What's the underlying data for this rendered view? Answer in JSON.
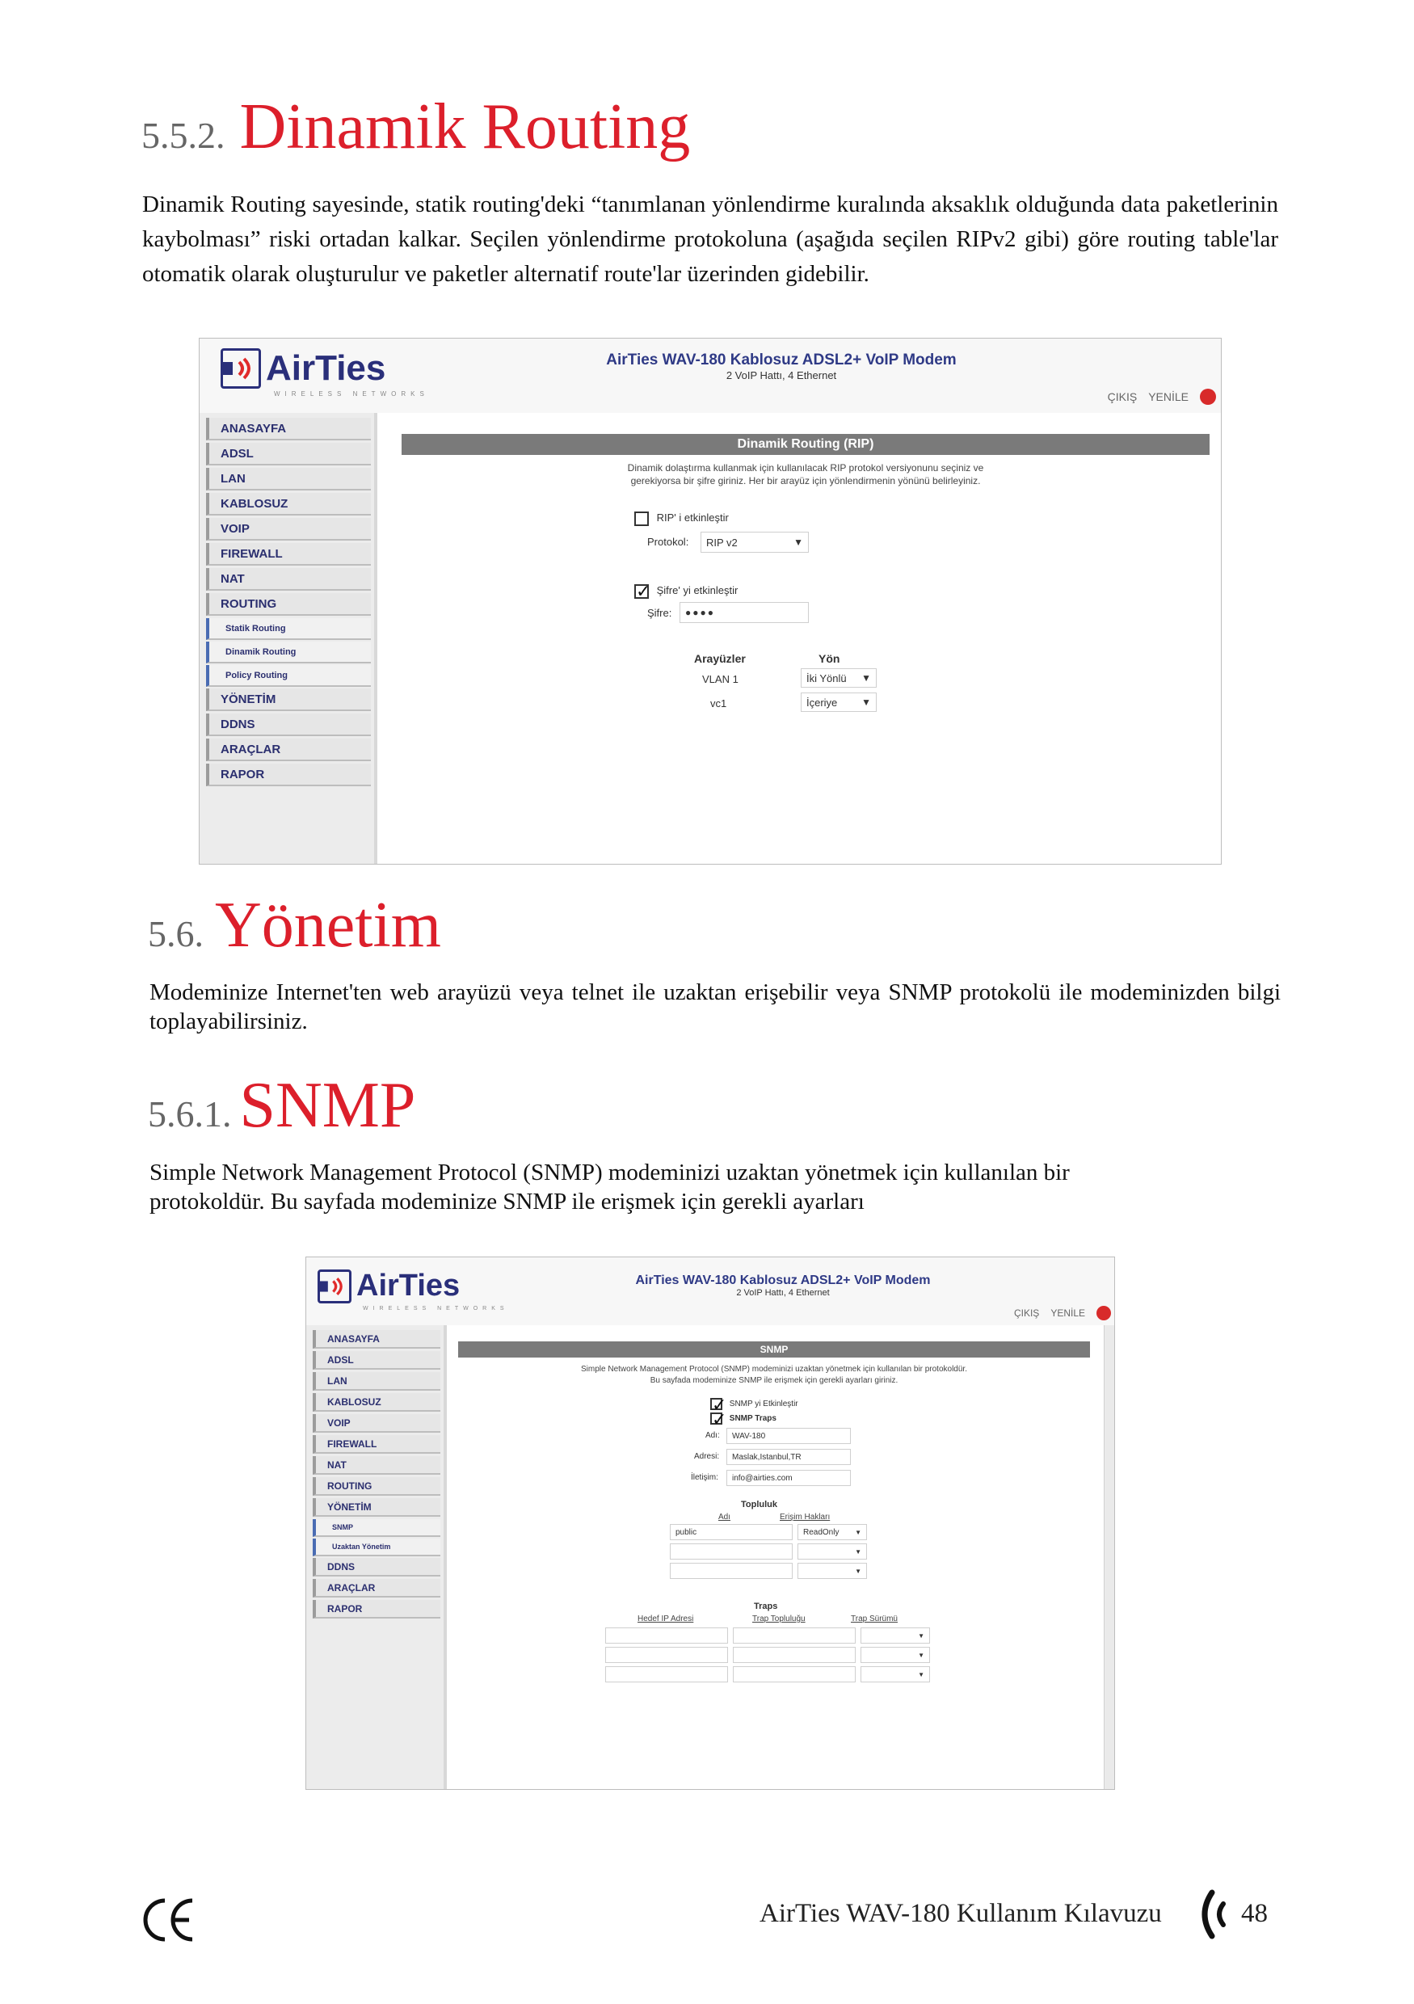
{
  "sections": {
    "s552": {
      "num": "5.5.2.",
      "title": "Dinamik Routing",
      "para": "Dinamik Routing sayesinde, statik routing'deki “tanımlanan yönlendirme kuralında aksaklık olduğunda data paketlerinin kaybolması” riski ortadan kalkar. Seçilen yönlendirme protokoluna (aşağıda seçilen RIPv2 gibi) göre routing table'lar otomatik olarak oluşturulur ve paketler alternatif route'lar üzerinden gidebilir."
    },
    "s56": {
      "num": "5.6.",
      "title": "Yönetim",
      "para": "Modeminize Internet'ten web arayüzü veya telnet ile uzaktan erişebilir veya SNMP protokolü ile modeminizden bilgi toplayabilirsiniz."
    },
    "s561": {
      "num": "5.6.1.",
      "title": "SNMP",
      "para1": "Simple Network Management Protocol (SNMP) modeminizi uzaktan yönetmek için kullanılan bir",
      "para2": "protokoldür. Bu sayfada modeminize SNMP ile erişmek için gerekli ayarları"
    }
  },
  "shot1": {
    "logo": "AirTies",
    "logo_sub": "WIRELESS NETWORKS",
    "model": "AirTies WAV-180 Kablosuz ADSL2+ VoIP Modem",
    "model_sub": "2 VoIP Hattı, 4 Ethernet",
    "exit": "ÇIKIŞ",
    "refresh": "YENİLE",
    "nav": [
      "ANASAYFA",
      "ADSL",
      "LAN",
      "KABLOSUZ",
      "VOIP",
      "FIREWALL",
      "NAT",
      "ROUTING"
    ],
    "subnav": [
      "Statik Routing",
      "Dinamik Routing",
      "Policy Routing"
    ],
    "nav2": [
      "YÖNETİM",
      "DDNS",
      "ARAÇLAR",
      "RAPOR"
    ],
    "panel_title": "Dinamik Routing (RIP)",
    "desc1": "Dinamik dolaştırma kullanmak için kullanılacak RIP protokol versiyonunu seçiniz ve",
    "desc2": "gerekiyorsa bir şifre giriniz. Her bir arayüz için yönlendirmenin yönünü belirleyiniz.",
    "rip_enable": "RIP' i etkinleştir",
    "protocol_label": "Protokol:",
    "protocol_value": "RIP v2",
    "pw_enable": "Şifre' yi etkinleştir",
    "pw_label": "Şifre:",
    "pw_value": "●●●●",
    "col_if": "Arayüzler",
    "col_dir": "Yön",
    "rows": [
      {
        "if": "VLAN 1",
        "dir": "İki Yönlü"
      },
      {
        "if": "vc1",
        "dir": "İçeriye"
      }
    ]
  },
  "shot2": {
    "logo": "AirTies",
    "logo_sub": "WIRELESS NETWORKS",
    "model": "AirTies WAV-180 Kablosuz ADSL2+ VoIP Modem",
    "model_sub": "2 VoIP Hattı, 4 Ethernet",
    "exit": "ÇIKIŞ",
    "refresh": "YENİLE",
    "nav": [
      "ANASAYFA",
      "ADSL",
      "LAN",
      "KABLOSUZ",
      "VOIP",
      "FIREWALL",
      "NAT",
      "ROUTING",
      "YÖNETİM"
    ],
    "subnav": [
      "SNMP",
      "Uzaktan Yönetim"
    ],
    "nav2": [
      "DDNS",
      "ARAÇLAR",
      "RAPOR"
    ],
    "panel_title": "SNMP",
    "desc1": "Simple Network Management Protocol (SNMP) modeminizi uzaktan yönetmek için kullanılan bir protokoldür.",
    "desc2": "Bu sayfada modeminize SNMP ile erişmek için gerekli ayarları giriniz.",
    "snmp_enable": "SNMP yi Etkinleştir",
    "snmp_traps": "SNMP Traps",
    "name_label": "Adı:",
    "name_value": "WAV-180",
    "addr_label": "Adresi:",
    "addr_value": "Maslak,Istanbul,TR",
    "contact_label": "İletişim:",
    "contact_value": "info@airties.com",
    "community_title": "Topluluk",
    "col_name": "Adı",
    "col_access": "Erişim Hakları",
    "community_rows": [
      {
        "name": "public",
        "access": "ReadOnly"
      },
      {
        "name": "",
        "access": ""
      },
      {
        "name": "",
        "access": ""
      }
    ],
    "traps_title": "Traps",
    "col_target": "Hedef IP Adresi",
    "col_community": "Trap Topluluğu",
    "col_version": "Trap Sürümü"
  },
  "footer": {
    "manual": "AirTies WAV-180 Kullanım Kılavuzu",
    "page": "48"
  }
}
